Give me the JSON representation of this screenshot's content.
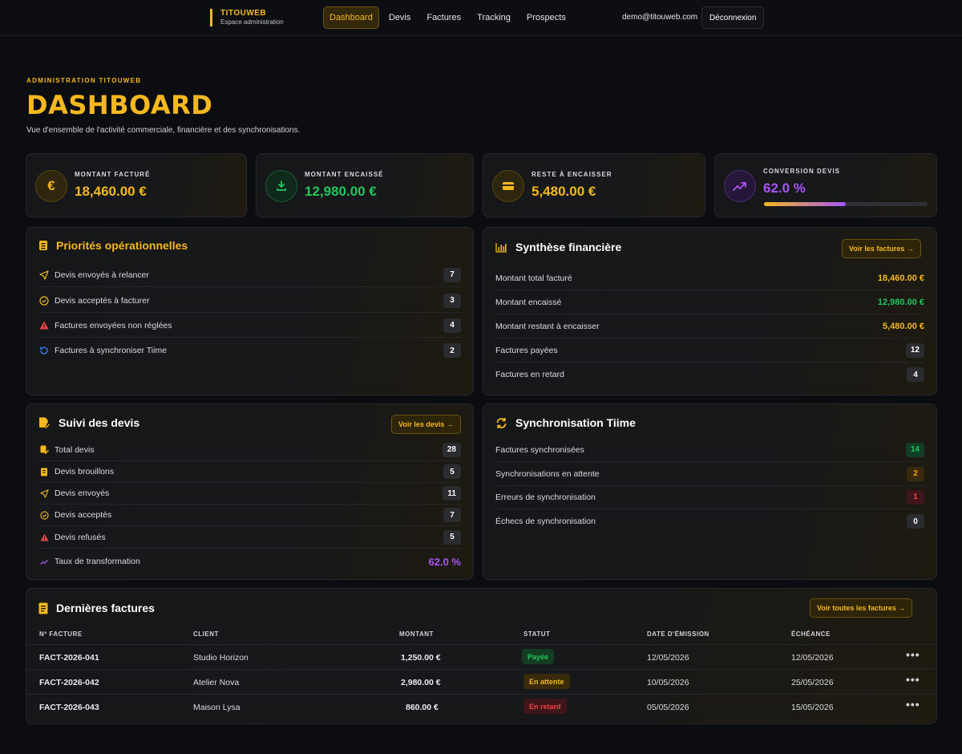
{
  "brand": {
    "name": "TITOUWEB",
    "subtitle": "Espace administration"
  },
  "nav": [
    {
      "label": "Dashboard",
      "active": true
    },
    {
      "label": "Devis"
    },
    {
      "label": "Factures"
    },
    {
      "label": "Tracking"
    },
    {
      "label": "Prospects"
    }
  ],
  "user": {
    "email": "demo@titouweb.com",
    "logout_label": "Déconnexion"
  },
  "header": {
    "eyebrow": "ADMINISTRATION TITOUWEB",
    "title": "DASHBOARD",
    "subtitle": "Vue d'ensemble de l'activité commerciale, financière et des synchronisations."
  },
  "kpis": [
    {
      "label": "MONTANT FACTURÉ",
      "value": "18,460.00 €",
      "color": "#f5b81f",
      "icon": "euro-icon"
    },
    {
      "label": "MONTANT ENCAISSÉ",
      "value": "12,980.00 €",
      "color": "#22c55e",
      "icon": "download-icon"
    },
    {
      "label": "RESTE À ENCAISSER",
      "value": "5,480.00 €",
      "color": "#f5b81f",
      "icon": "credit-card-icon"
    },
    {
      "label": "CONVERSION DEVIS",
      "value": "62.0 %",
      "color": "#a855f7",
      "icon": "trending-up-icon",
      "progress": 0.5
    }
  ],
  "priorities": {
    "title": "Priorités opérationnelles",
    "items": [
      {
        "label": "Devis envoyés à relancer",
        "count": "7",
        "icon": "send-icon"
      },
      {
        "label": "Devis acceptés à facturer",
        "count": "3",
        "icon": "check-circle-icon"
      },
      {
        "label": "Factures envoyées non réglées",
        "count": "4",
        "icon": "warning-icon"
      },
      {
        "label": "Factures à synchroniser Tiime",
        "count": "2",
        "icon": "refresh-icon"
      }
    ]
  },
  "finance": {
    "title": "Synthèse financière",
    "button": "Voir les factures →",
    "items": [
      {
        "label": "Montant total facturé",
        "value": "18,460.00 €",
        "color": "#f5b81f"
      },
      {
        "label": "Montant encaissé",
        "value": "12,980.00 €",
        "color": "#22c55e"
      },
      {
        "label": "Montant restant à encaisser",
        "value": "5,480.00 €",
        "color": "#f5b81f"
      },
      {
        "label": "Factures payées",
        "value": "12"
      },
      {
        "label": "Factures en retard",
        "value": "4"
      }
    ]
  },
  "quotes": {
    "title": "Suivi des devis",
    "button": "Voir les devis →",
    "items": [
      {
        "label": "Total devis",
        "value": "28",
        "icon": "file-edit-icon"
      },
      {
        "label": "Devis brouillons",
        "value": "5",
        "icon": "draft-icon"
      },
      {
        "label": "Devis envoyés",
        "value": "11",
        "icon": "send-icon"
      },
      {
        "label": "Devis acceptés",
        "value": "7",
        "icon": "check-circle-icon"
      },
      {
        "label": "Devis refusés",
        "value": "5",
        "icon": "warning-icon"
      },
      {
        "label": "Taux de transformation",
        "value": "62.0 %",
        "icon": "trending-up-icon"
      }
    ]
  },
  "sync": {
    "title": "Synchronisation Tiime",
    "items": [
      {
        "label": "Factures synchronisées",
        "value": "14",
        "color": "#22c55e"
      },
      {
        "label": "Synchronisations en attente",
        "value": "2",
        "color": "#f59e0b"
      },
      {
        "label": "Erreurs de synchronisation",
        "value": "1",
        "color": "#ef4444"
      },
      {
        "label": "Échecs de synchronisation",
        "value": "0"
      }
    ]
  },
  "invoices": {
    "title": "Dernières factures",
    "button": "Voir toutes les factures →",
    "columns": [
      "Nº FACTURE",
      "CLIENT",
      "MONTANT",
      "STATUT",
      "DATE D'ÉMISSION",
      "ÉCHÉANCE"
    ],
    "rows": [
      {
        "number": "FACT-2026-041",
        "client": "Studio Horizon",
        "amount": "1,250.00 €",
        "status": "Payée",
        "issued": "12/05/2026",
        "due": "12/05/2026"
      },
      {
        "number": "FACT-2026-042",
        "client": "Atelier Nova",
        "amount": "2,980.00 €",
        "status": "En attente",
        "issued": "10/05/2026",
        "due": "25/05/2026"
      },
      {
        "number": "FACT-2026-043",
        "client": "Maison Lysa",
        "amount": "860.00 €",
        "status": "En retard",
        "issued": "05/05/2026",
        "due": "15/05/2026"
      }
    ]
  }
}
